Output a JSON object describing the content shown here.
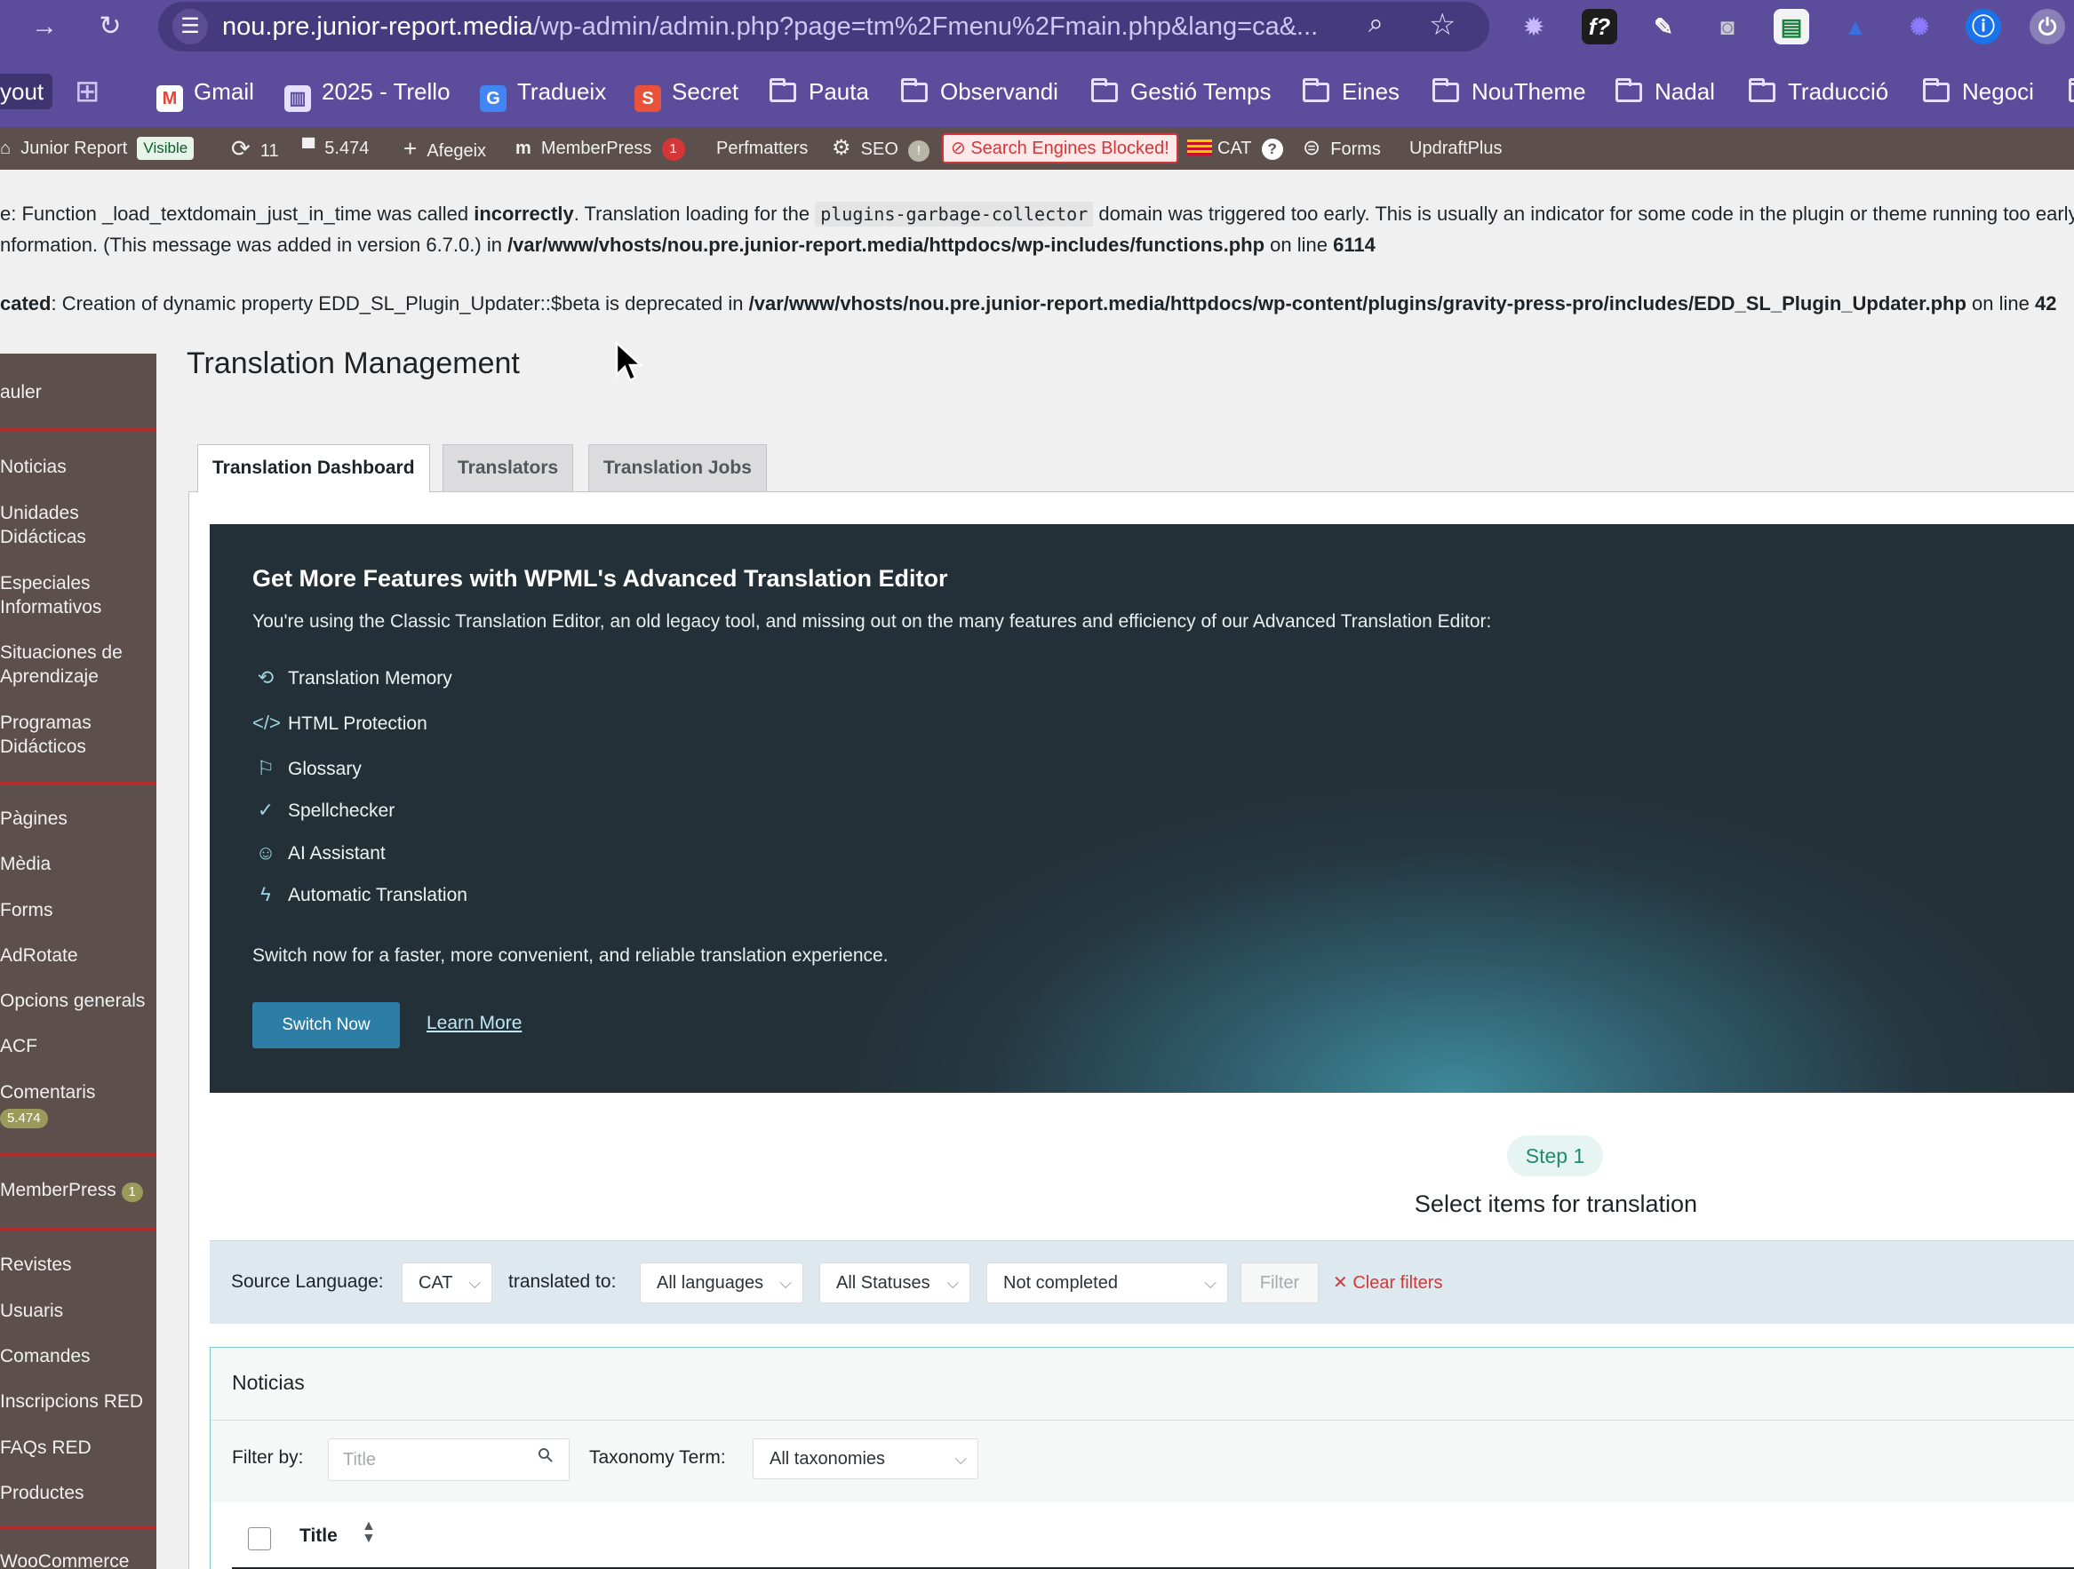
{
  "browser": {
    "url_host": "nou.pre.junior-report.media",
    "url_path": "/wp-admin/admin.php?page=tm%2Fmenu%2Fmain.php&lang=ca&...",
    "bookmarks": [
      {
        "label": "yout"
      },
      {
        "label": "Gmail",
        "icon": "gmail-icon"
      },
      {
        "label": "2025 - Trello",
        "icon": "trello-icon"
      },
      {
        "label": "Tradueix",
        "icon": "translate-icon"
      },
      {
        "label": "Secret",
        "icon": "s-icon"
      },
      {
        "label": "Pauta",
        "icon": "folder-icon"
      },
      {
        "label": "Observandi",
        "icon": "folder-icon"
      },
      {
        "label": "Gestió Temps",
        "icon": "folder-icon"
      },
      {
        "label": "Eines",
        "icon": "folder-icon"
      },
      {
        "label": "NouTheme",
        "icon": "folder-icon"
      },
      {
        "label": "Nadal",
        "icon": "folder-icon"
      },
      {
        "label": "Traducció",
        "icon": "folder-icon"
      },
      {
        "label": "Negoci",
        "icon": "folder-icon"
      }
    ]
  },
  "adminbar": {
    "site": "Junior Report",
    "visible": "Visible",
    "updates": "11",
    "comments": "5.474",
    "add": "Afegeix",
    "memberpress": "MemberPress",
    "memberpress_count": "1",
    "perfmatters": "Perfmatters",
    "seo": "SEO",
    "seo_badge": "!",
    "blocked": "Search Engines Blocked!",
    "lang": "CAT",
    "lang_help": "?",
    "forms": "Forms",
    "updraft": "UpdraftPlus"
  },
  "notices": {
    "n1_a": "e: Function _load_textdomain_just_in_time was called ",
    "n1_b": "incorrectly",
    "n1_c": ". Translation loading for the ",
    "n1_code": "plugins-garbage-collector",
    "n1_d": " domain was triggered too early. This is usually an indicator for some code in the plugin or theme running too early",
    "n2_a": "nformation. (This message was added in version 6.7.0.) in ",
    "n2_b": "/var/www/vhosts/nou.pre.junior-report.media/httpdocs/wp-includes/functions.php",
    "n2_c": " on line ",
    "n2_d": "6114",
    "n3_a": "cated",
    "n3_b": ": Creation of dynamic property EDD_SL_Plugin_Updater::$beta is deprecated in ",
    "n3_c": "/var/www/vhosts/nou.pre.junior-report.media/httpdocs/wp-content/plugins/gravity-press-pro/includes/EDD_SL_Plugin_Updater.php",
    "n3_d": " on line ",
    "n3_e": "42"
  },
  "sidebar": {
    "items": [
      "auler",
      "Noticias",
      "Unidades\nDidácticas",
      "Especiales\nInformativos",
      "Situaciones de\nAprendizaje",
      "Programas\nDidácticos",
      "Pàgines",
      "Mèdia",
      "Forms",
      "AdRotate",
      "Opcions generals",
      "ACF",
      "Comentaris",
      "MemberPress",
      "Revistes",
      "Usuaris",
      "Comandes",
      "Inscripcions RED",
      "FAQs RED",
      "Productes",
      "WooCommerce"
    ],
    "comments_badge": "5.474",
    "memberpress_badge": "1"
  },
  "page": {
    "title": "Translation Management",
    "tabs": [
      "Translation Dashboard",
      "Translators",
      "Translation Jobs"
    ]
  },
  "promo": {
    "title": "Get More Features with WPML's Advanced Translation Editor",
    "subtitle": "You're using the Classic Translation Editor, an old legacy tool, and missing out on the many features and efficiency of our Advanced Translation Editor:",
    "features": [
      {
        "label": "Translation Memory",
        "icon": "history-icon"
      },
      {
        "label": "HTML Protection",
        "icon": "code-icon"
      },
      {
        "label": "Glossary",
        "icon": "bookmark-icon"
      },
      {
        "label": "Spellchecker",
        "icon": "spellcheck-icon"
      },
      {
        "label": "AI Assistant",
        "icon": "robot-icon"
      },
      {
        "label": "Automatic Translation",
        "icon": "bolt-icon"
      }
    ],
    "footer": "Switch now for a faster, more convenient, and reliable translation experience.",
    "switch_label": "Switch Now",
    "learn_label": "Learn More"
  },
  "step": {
    "badge": "Step 1",
    "title": "Select items for translation"
  },
  "filters": {
    "source_label": "Source Language:",
    "source_value": "CAT",
    "translated_label": "translated to:",
    "languages_value": "All languages",
    "statuses_value": "All Statuses",
    "completion_value": "Not completed",
    "filter_label": "Filter",
    "clear_label": "Clear filters"
  },
  "section": {
    "title": "Noticias",
    "filter_by": "Filter by:",
    "title_placeholder": "Title",
    "taxonomy_label": "Taxonomy Term:",
    "taxonomy_value": "All taxonomies",
    "col_title": "Title"
  }
}
